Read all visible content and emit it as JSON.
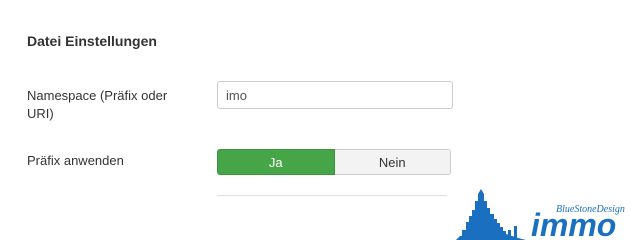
{
  "section": {
    "title": "Datei Einstellungen"
  },
  "namespace_field": {
    "label": "Namespace (Präfix oder URI)",
    "value": "imo"
  },
  "prefix_field": {
    "label": "Präfix anwenden",
    "options": [
      "Ja",
      "Nein"
    ],
    "selected": "Ja",
    "colors": {
      "selected": "#46a546",
      "unselected": "#f3f3f3"
    }
  },
  "logo": {
    "brand": "BlueStoneDesign",
    "wordmark": "immo",
    "color": "#1a6fc0"
  }
}
